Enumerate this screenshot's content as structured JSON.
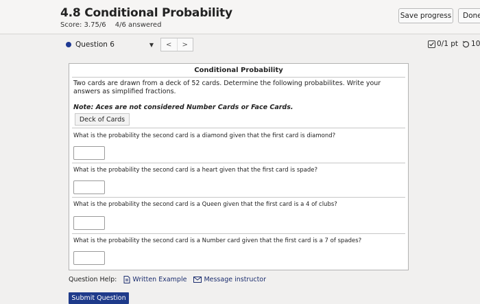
{
  "header": {
    "title": "4.8 Conditional Probability",
    "score_label": "Score: 3.75/6",
    "answered_label": "4/6 answered",
    "save_button": "Save progress",
    "done_button": "Done"
  },
  "question_nav": {
    "selected_question": "Question 6",
    "prev_glyph": "<",
    "next_glyph": ">",
    "points": "0/1 pt",
    "retries": "10"
  },
  "problem": {
    "title": "Conditional Probability",
    "intro": "Two cards are drawn from a deck of 52 cards. Determine the following probabilites. Write your answers as simplified fractions.",
    "note": "Note: Aces are not considered Number Cards or Face Cards.",
    "deck_button": "Deck of Cards",
    "questions": [
      {
        "text": "What is the probability the second card is a diamond given that the first card is diamond?",
        "answer": ""
      },
      {
        "text": "What is the probability the second card is a heart given that the first card is spade?",
        "answer": ""
      },
      {
        "text": "What is the probability the second card is a Queen given that the first card is a 4 of clubs?",
        "answer": ""
      },
      {
        "text": "What is the probability the second card is a Number card given that the first card is a 7 of spades?",
        "answer": ""
      }
    ]
  },
  "help": {
    "label": "Question Help:",
    "written_example": "Written Example",
    "message_instructor": "Message instructor"
  },
  "submit_button": "Submit Question",
  "colors": {
    "accent": "#1e3a8a",
    "link": "#1b2d6e",
    "background": "#f1f0ef"
  }
}
